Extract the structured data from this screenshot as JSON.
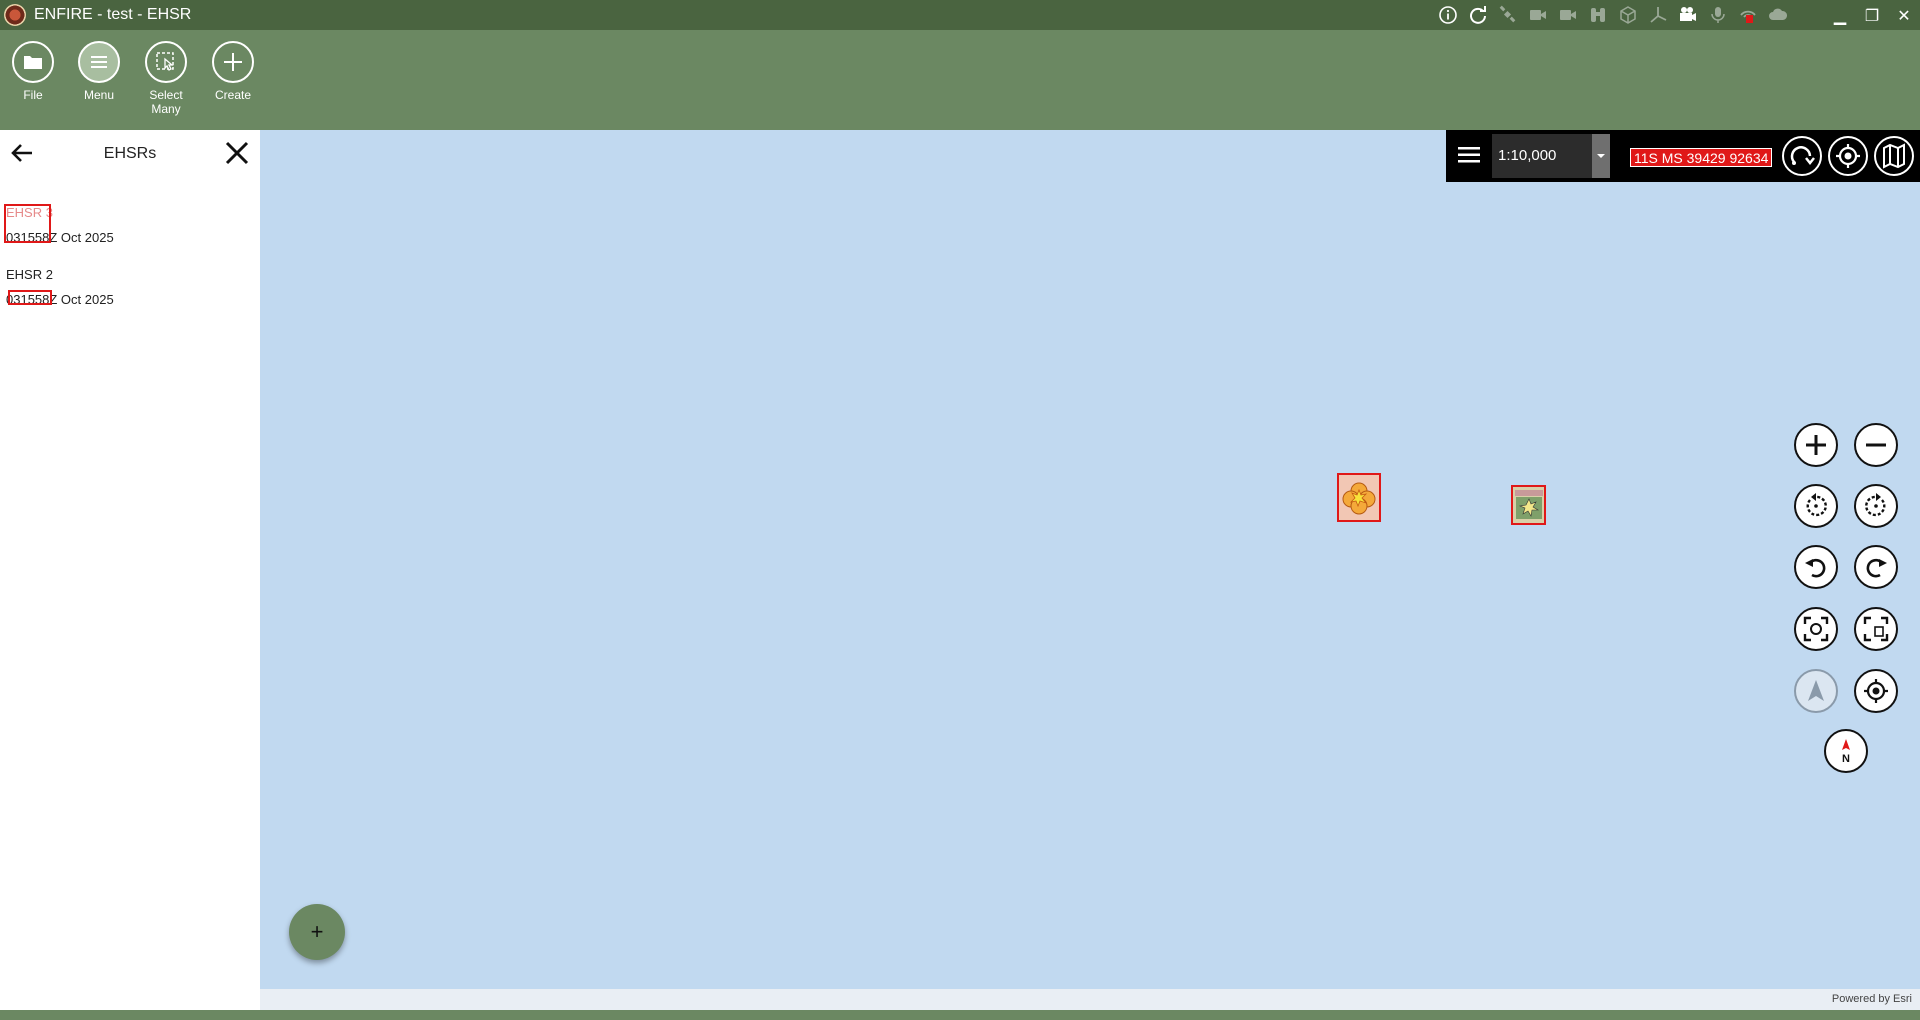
{
  "window": {
    "title": "ENFIRE - test - EHSR",
    "controls": [
      "minimize",
      "restore",
      "close"
    ]
  },
  "tray_icons": [
    "info-icon",
    "refresh-icon",
    "satellite-icon",
    "video-icon",
    "camera-icon",
    "binoculars-icon",
    "cube-icon",
    "axis-icon",
    "camcorder-icon",
    "microphone-icon",
    "signal-icon",
    "cloud-icon"
  ],
  "ribbon": {
    "file_label": "File",
    "menu_label": "Menu",
    "select_many_label": "Select Many",
    "create_label": "Create"
  },
  "panel": {
    "title": "EHSRs",
    "items": [
      {
        "name": "EHSR 3",
        "dtg": "031558Z Oct 2025"
      },
      {
        "name": "EHSR 2",
        "dtg": "031558Z Oct 2025"
      }
    ]
  },
  "map_toolbar": {
    "scale": "1:10,000",
    "coordinate": "11S MS 39429 92634"
  },
  "map": {
    "attribution": "Powered by Esri",
    "north_label": "N",
    "fab_label": "+"
  },
  "colors": {
    "titlebar": "#4a6440",
    "ribbon": "#6b8862",
    "map_water": "#c1d9f0",
    "highlight": "#e01818"
  }
}
